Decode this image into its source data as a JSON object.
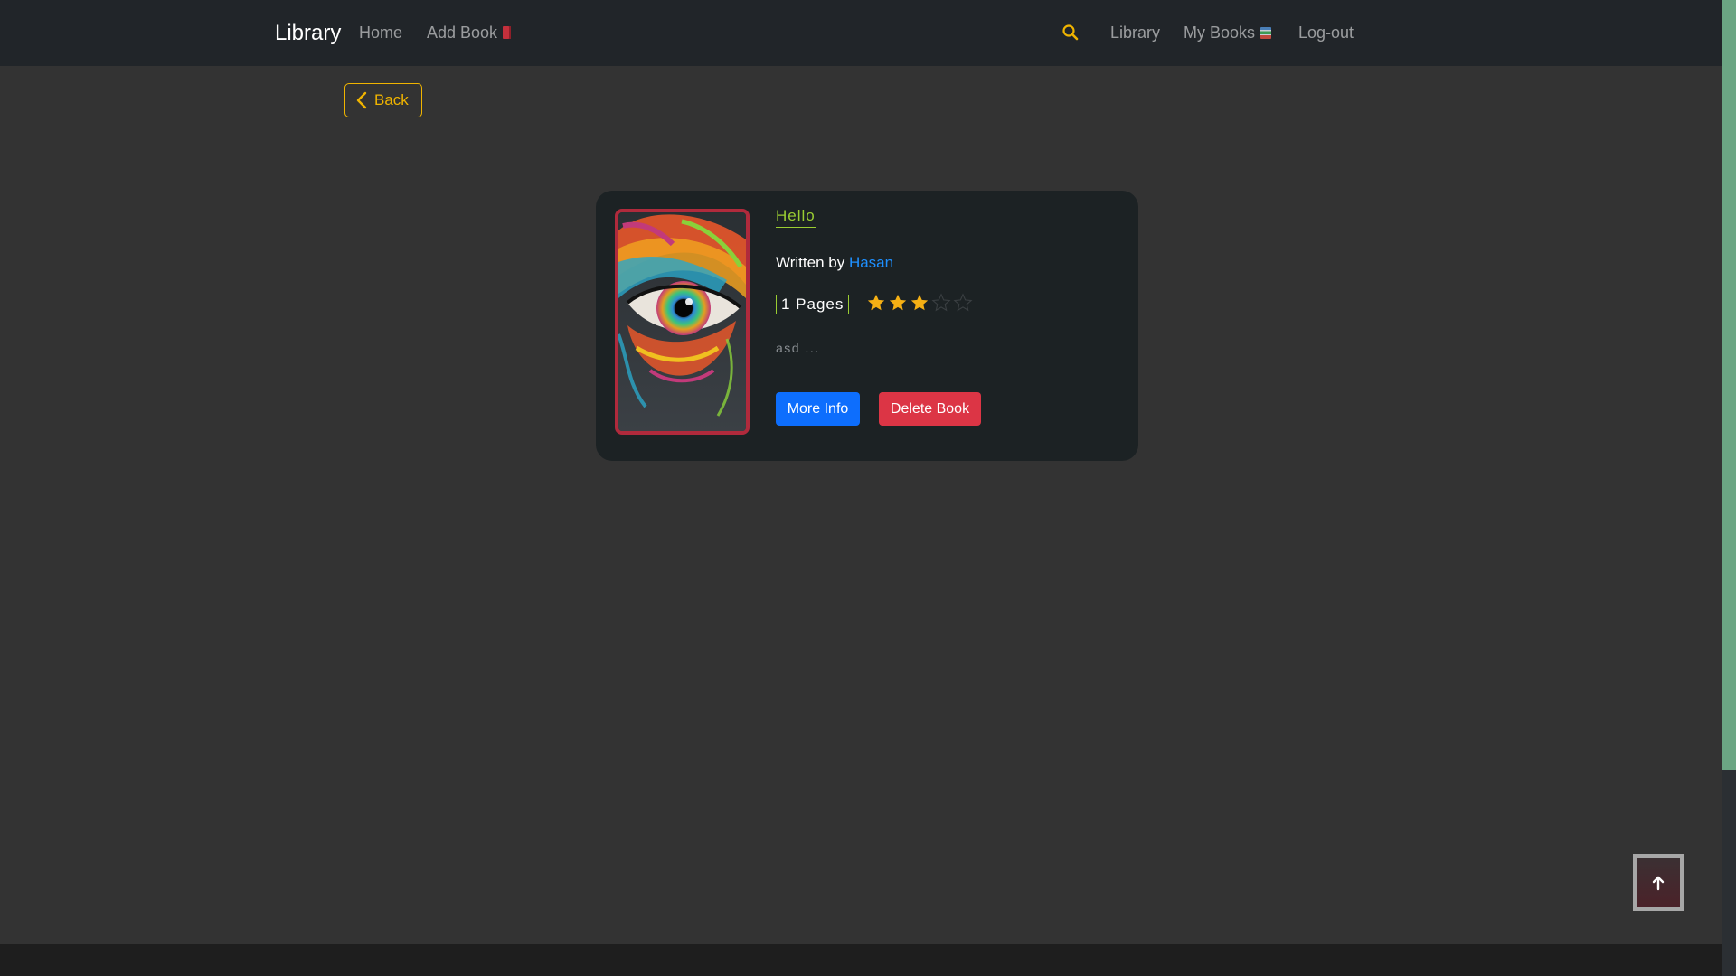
{
  "navbar": {
    "brand": "Library",
    "home": "Home",
    "add_book": "Add Book",
    "library": "Library",
    "my_books": "My Books",
    "logout": "Log-out"
  },
  "back_label": "Back",
  "book": {
    "title": "Hello",
    "written_by": "Written by",
    "author": "Hasan",
    "pages": "1 Pages",
    "rating": 3,
    "rating_max": 5,
    "description": "asd ...",
    "more_info_label": "More Info",
    "delete_label": "Delete Book"
  },
  "colors": {
    "accent_yellow": "#f0b400",
    "title_green": "#9acd32",
    "author_blue": "#1e90ff",
    "primary": "#0d6efd",
    "danger": "#dc3545",
    "cover_border": "#b02a3c"
  },
  "icons": {
    "search": "search-icon",
    "back": "chevron-left-icon",
    "scroll_top": "arrow-up-icon",
    "star": "star-icon"
  }
}
